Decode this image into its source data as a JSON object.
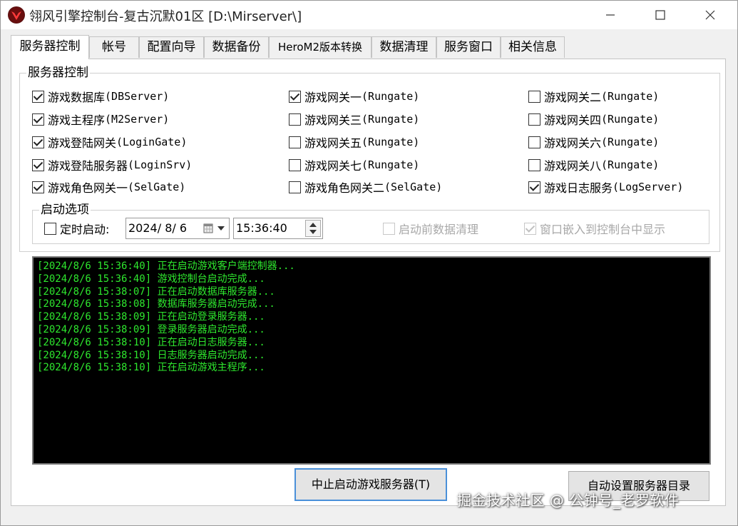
{
  "window": {
    "title": "翎风引擎控制台-复古沉默01区 [D:\\Mirserver\\]",
    "controls": {
      "minimize": "─",
      "maximize": "☐",
      "close": "✕"
    }
  },
  "tabs": [
    {
      "label": "服务器控制",
      "active": true
    },
    {
      "label": "帐号"
    },
    {
      "label": "配置向导"
    },
    {
      "label": "数据备份"
    },
    {
      "label": "HeroM2版本转换"
    },
    {
      "label": "数据清理"
    },
    {
      "label": "服务窗口"
    },
    {
      "label": "相关信息"
    }
  ],
  "server_group": {
    "title": "服务器控制",
    "checkboxes": [
      {
        "cn": "游戏数据库",
        "en": "(DBServer)",
        "checked": true
      },
      {
        "cn": "游戏网关一",
        "en": "(Rungate)",
        "checked": true
      },
      {
        "cn": "游戏网关二",
        "en": "(Rungate)",
        "checked": false
      },
      {
        "cn": "游戏主程序",
        "en": "(M2Server)",
        "checked": true
      },
      {
        "cn": "游戏网关三",
        "en": "(Rungate)",
        "checked": false
      },
      {
        "cn": "游戏网关四",
        "en": "(Rungate)",
        "checked": false
      },
      {
        "cn": "游戏登陆网关",
        "en": "(LoginGate)",
        "checked": true
      },
      {
        "cn": "游戏网关五",
        "en": "(Rungate)",
        "checked": false
      },
      {
        "cn": "游戏网关六",
        "en": "(Rungate)",
        "checked": false
      },
      {
        "cn": "游戏登陆服务器",
        "en": "(LoginSrv)",
        "checked": true
      },
      {
        "cn": "游戏网关七",
        "en": "(Rungate)",
        "checked": false
      },
      {
        "cn": "游戏网关八",
        "en": "(Rungate)",
        "checked": false
      },
      {
        "cn": "游戏角色网关一",
        "en": "(SelGate)",
        "checked": true
      },
      {
        "cn": "游戏角色网关二",
        "en": "(SelGate)",
        "checked": false
      },
      {
        "cn": "游戏日志服务",
        "en": "(LogServer)",
        "checked": true
      }
    ]
  },
  "startup": {
    "title": "启动选项",
    "timed_start_label": "定时启动:",
    "timed_start_checked": false,
    "date_value": "2024/ 8/ 6",
    "time_value": "15:36:40",
    "clean_before_start_label": "启动前数据清理",
    "clean_before_start_checked": false,
    "embed_window_label": "窗口嵌入到控制台中显示",
    "embed_window_checked": true
  },
  "log": [
    "[2024/8/6 15:36:40] 正在启动游戏客户端控制器...",
    "[2024/8/6 15:36:40] 游戏控制台启动完成...",
    "[2024/8/6 15:38:07] 正在启动数据库服务器...",
    "[2024/8/6 15:38:08] 数据库服务器启动完成...",
    "[2024/8/6 15:38:09] 正在启动登录服务器...",
    "[2024/8/6 15:38:09] 登录服务器启动完成...",
    "[2024/8/6 15:38:10] 正在启动日志服务器...",
    "[2024/8/6 15:38:10] 日志服务器启动完成...",
    "[2024/8/6 15:38:10] 正在启动游戏主程序..."
  ],
  "buttons": {
    "stop_start": "中止启动游戏服务器(T)",
    "auto_set_dir": "自动设置服务器目录"
  },
  "watermark": "掘金技术社区 @ 公钟号_老罗软件",
  "colors": {
    "console_bg": "#000000",
    "console_text": "#2ee82e",
    "focus_border": "#4a90d9"
  }
}
